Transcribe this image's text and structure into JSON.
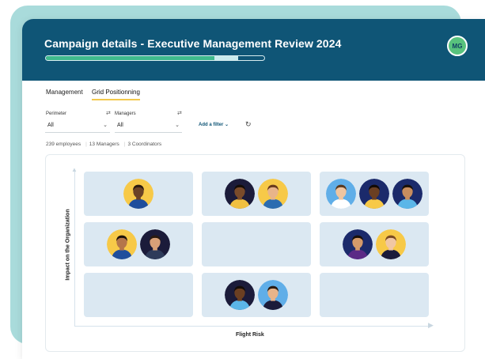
{
  "header": {
    "title": "Campaign details - Executive Management Review 2024",
    "progress": {
      "complete_fraction": 0.77,
      "partial_fraction": 0.11
    },
    "avatar_initials": "MG"
  },
  "tabs": [
    {
      "label": "Management",
      "active": false
    },
    {
      "label": "Grid Positionning",
      "active": true
    }
  ],
  "filters": {
    "perimeter": {
      "label": "Perimeter",
      "value": "All"
    },
    "managers": {
      "label": "Managers",
      "value": "All"
    },
    "add_filter_label": "Add a filter"
  },
  "stats": {
    "employees": "239 employees",
    "managers": "13 Managers",
    "coordinators": "3 Coordinators"
  },
  "grid": {
    "y_axis_label": "Impact on the Organization",
    "x_axis_label": "Flight Risk",
    "cells": [
      {
        "row": 0,
        "col": 0,
        "people": [
          {
            "bg": "#f7c948",
            "skin": "#6b4226",
            "hair": "#2b1a10",
            "shirt": "#1f4e9c"
          }
        ]
      },
      {
        "row": 0,
        "col": 1,
        "people": [
          {
            "bg": "#1b1b3a",
            "skin": "#7a4b2a",
            "hair": "#140c08",
            "shirt": "#f0c040"
          },
          {
            "bg": "#f7c948",
            "skin": "#e8b48a",
            "hair": "#6a3b1e",
            "shirt": "#2b6cb0"
          }
        ]
      },
      {
        "row": 0,
        "col": 2,
        "people": [
          {
            "bg": "#60aee8",
            "skin": "#f0c5a0",
            "hair": "#5a3a20",
            "shirt": "#ffffff"
          },
          {
            "bg": "#1b2a6b",
            "skin": "#6b3f22",
            "hair": "#120a05",
            "shirt": "#f7c948"
          },
          {
            "bg": "#1b2a6b",
            "skin": "#c98d5e",
            "hair": "#1a1008",
            "shirt": "#5bb6e8"
          }
        ]
      },
      {
        "row": 1,
        "col": 0,
        "people": [
          {
            "bg": "#f7c948",
            "skin": "#b5764a",
            "hair": "#1d120a",
            "shirt": "#1f4e9c"
          },
          {
            "bg": "#1b1b3a",
            "skin": "#d9a078",
            "hair": "#2a1a10",
            "shirt": "#2e3b5a"
          }
        ]
      },
      {
        "row": 1,
        "col": 1,
        "people": []
      },
      {
        "row": 1,
        "col": 2,
        "people": [
          {
            "bg": "#1b2a6b",
            "skin": "#d49a6a",
            "hair": "#1a0f08",
            "shirt": "#5b2a86"
          },
          {
            "bg": "#f7c948",
            "skin": "#f1c7a3",
            "hair": "#7a4a22",
            "shirt": "#1b1b3a"
          }
        ]
      },
      {
        "row": 2,
        "col": 0,
        "people": []
      },
      {
        "row": 2,
        "col": 1,
        "people": [
          {
            "bg": "#1b1b3a",
            "skin": "#6b3f22",
            "hair": "#140c08",
            "shirt": "#5bb6e8"
          },
          {
            "bg": "#60aee8",
            "skin": "#e8b48a",
            "hair": "#2a1a10",
            "shirt": "#1b1b3a"
          }
        ]
      },
      {
        "row": 2,
        "col": 2,
        "people": []
      }
    ]
  },
  "icons": {
    "sort": "sort-icon",
    "reset": "reset-icon",
    "chevron": "chevron-down-icon"
  }
}
